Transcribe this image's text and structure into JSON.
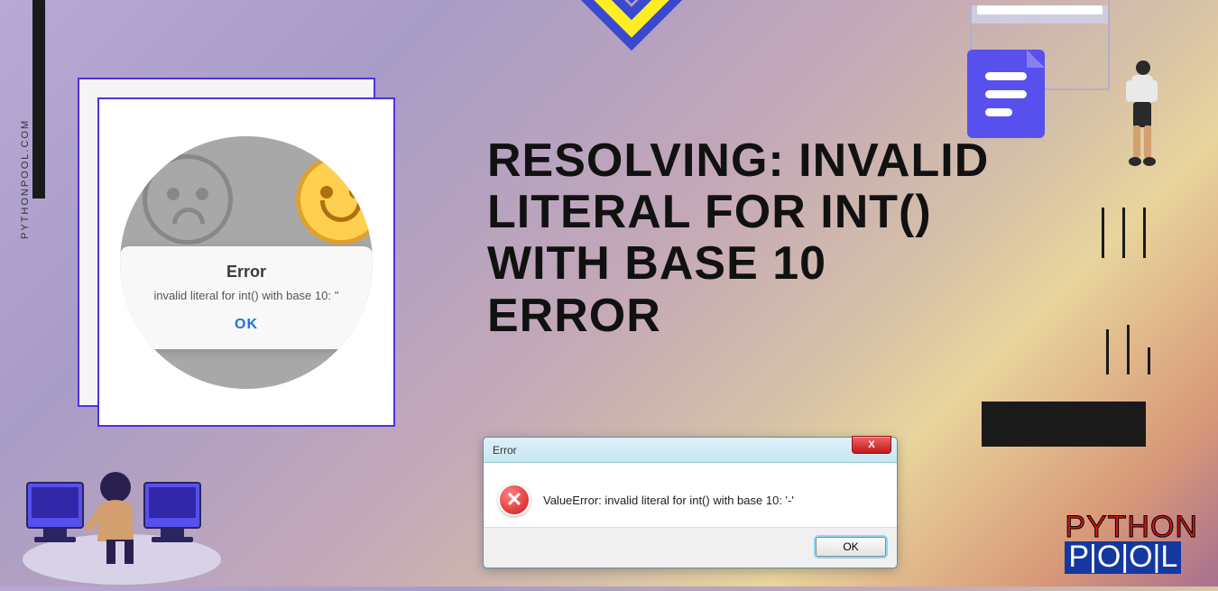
{
  "site_url": "PYTHONPOOL.COM",
  "headline": "RESOLVING: INVALID LITERAL FOR INT() WITH BASE 10 ERROR",
  "bubble": {
    "title": "Error",
    "message": "invalid literal for int() with base 10: ''",
    "ok": "OK"
  },
  "win7": {
    "title": "Error",
    "close": "X",
    "message": "ValueError: invalid literal for int() with base 10: '-'",
    "ok": "OK"
  },
  "logo": {
    "top": "PYTHON",
    "bottom": "P|O|O|L"
  }
}
